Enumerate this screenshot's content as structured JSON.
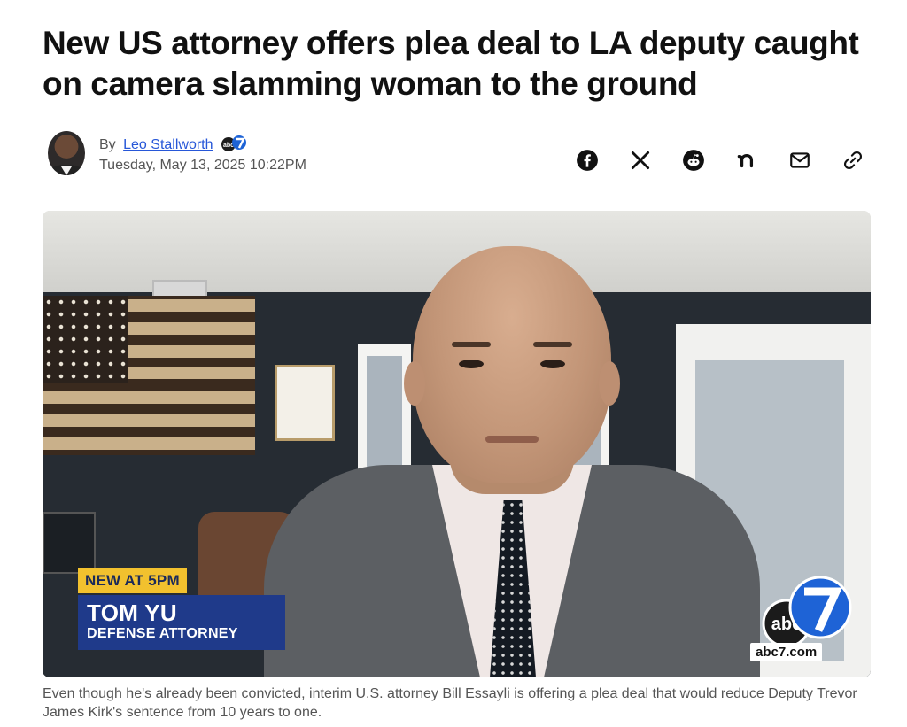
{
  "article": {
    "headline": "New US attorney offers plea deal to LA deputy caught on camera slamming woman to the ground",
    "byline_prefix": "By",
    "author": "Leo Stallworth",
    "author_station_icon": "abc7-logo-icon",
    "date": "Tuesday, May 13, 2025 10:22PM"
  },
  "share": [
    {
      "icon": "facebook-icon"
    },
    {
      "icon": "x-icon"
    },
    {
      "icon": "reddit-icon"
    },
    {
      "icon": "nextdoor-icon"
    },
    {
      "icon": "email-icon"
    },
    {
      "icon": "copy-link-icon"
    }
  ],
  "video": {
    "lower_third_tag": "NEW AT 5PM",
    "lower_third_name": "TOM YU",
    "lower_third_role": "DEFENSE ATTORNEY",
    "station_url": "abc7.com",
    "station_logo": "abc7-logo-icon",
    "colors": {
      "tag_yellow": "#f2c12e",
      "name_blue": "#1f3a8a",
      "abc_blue": "#1e63d6"
    }
  },
  "caption": "Even though he's already been convicted, interim U.S. attorney Bill Essayli is offering a plea deal that would reduce Deputy Trevor James Kirk's sentence from 10 years to one."
}
